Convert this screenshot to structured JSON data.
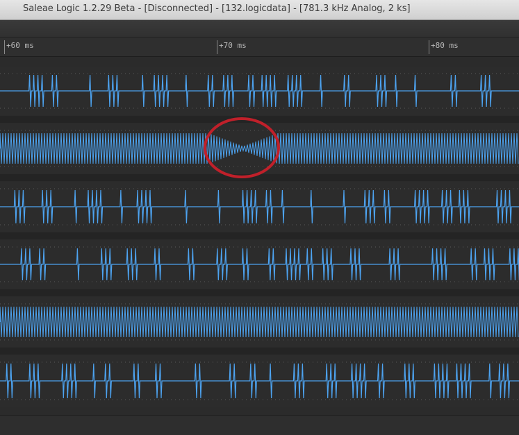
{
  "window": {
    "title": "Saleae Logic 1.2.29 Beta - [Disconnected] - [132.logicdata] - [781.3 kHz Analog, 2 ks]"
  },
  "timeline": {
    "ticks": [
      "+60 ms",
      "+70 ms",
      "+80 ms"
    ]
  },
  "colors": {
    "trace": "#4da3f0",
    "background": "#2c2c2c",
    "annotation_circle": "#c0202a"
  },
  "channels": [
    {
      "pattern": "sparse-bursts"
    },
    {
      "pattern": "dense-carrier-with-dip"
    },
    {
      "pattern": "sparse-bursts"
    },
    {
      "pattern": "sparse-bursts"
    },
    {
      "pattern": "dense-carrier"
    },
    {
      "pattern": "sparse-bursts"
    }
  ],
  "annotation": {
    "shape": "circle",
    "meaning": "highlighted-region"
  }
}
